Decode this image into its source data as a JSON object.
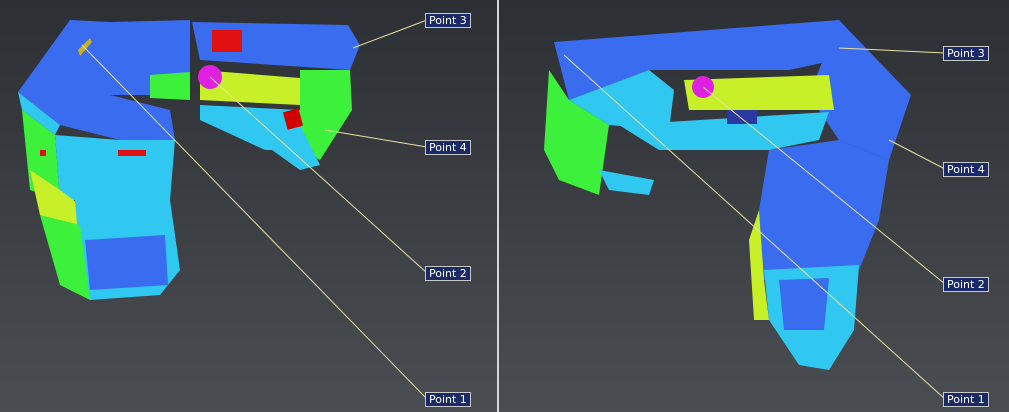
{
  "left_view": {
    "labels": [
      "Point 3",
      "Point 4",
      "Point 2",
      "Point 1"
    ]
  },
  "right_view": {
    "labels": [
      "Point 3",
      "Point 4",
      "Point 2",
      "Point 1"
    ]
  },
  "colors": {
    "blue": "#3a6cf0",
    "cyan": "#30c8f0",
    "green": "#3cf03c",
    "yellow_green": "#c8f028",
    "red": "#e01010",
    "magenta": "#e020e0",
    "leader_line": "#e8e0a0"
  }
}
